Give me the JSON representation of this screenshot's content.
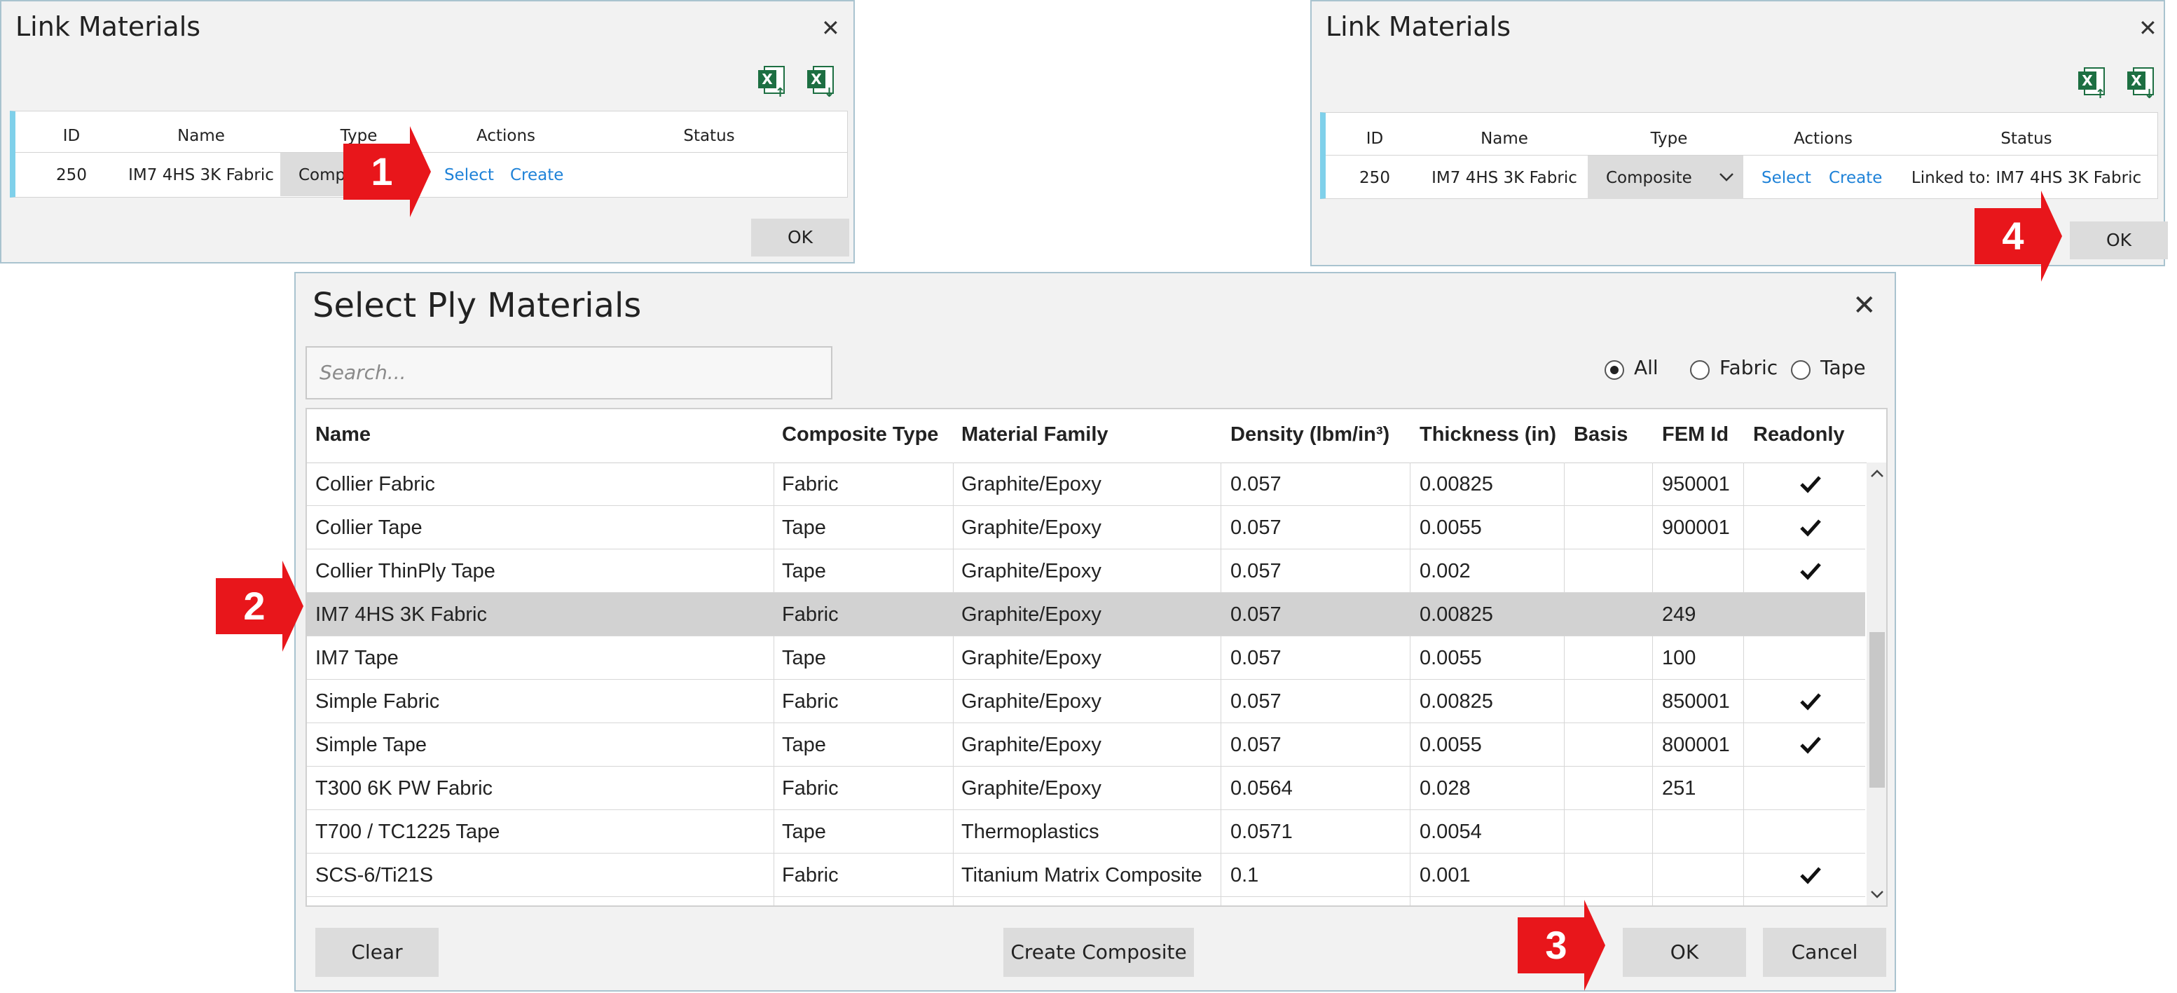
{
  "link_dialog_1": {
    "title": "Link Materials",
    "headers": {
      "id": "ID",
      "name": "Name",
      "type": "Type",
      "actions": "Actions",
      "status": "Status"
    },
    "row": {
      "id": "250",
      "name": "IM7 4HS 3K Fabric",
      "type": "Compo",
      "select": "Select",
      "create": "Create",
      "status": ""
    },
    "ok_label": "OK",
    "icons": [
      "excel-import-icon",
      "excel-export-icon",
      "close-icon"
    ]
  },
  "link_dialog_2": {
    "title": "Link Materials",
    "headers": {
      "id": "ID",
      "name": "Name",
      "type": "Type",
      "actions": "Actions",
      "status": "Status"
    },
    "row": {
      "id": "250",
      "name": "IM7 4HS 3K Fabric",
      "type": "Composite",
      "select": "Select",
      "create": "Create",
      "status": "Linked to: IM7 4HS 3K Fabric"
    },
    "ok_label": "OK",
    "icons": [
      "excel-import-icon",
      "excel-export-icon",
      "close-icon",
      "chevron-down-icon"
    ]
  },
  "select_dialog": {
    "title": "Select Ply Materials",
    "search_placeholder": "Search...",
    "filters": [
      {
        "label": "All",
        "selected": true
      },
      {
        "label": "Fabric",
        "selected": false
      },
      {
        "label": "Tape",
        "selected": false
      }
    ],
    "columns": [
      "Name",
      "Composite Type",
      "Material Family",
      "Density (lbm/in³)",
      "Thickness (in)",
      "Basis",
      "FEM Id",
      "Readonly"
    ],
    "rows": [
      {
        "name": "Collier Fabric",
        "type": "Fabric",
        "family": "Graphite/Epoxy",
        "density": "0.057",
        "thickness": "0.00825",
        "basis": "",
        "fem": "950001",
        "readonly": true
      },
      {
        "name": "Collier Tape",
        "type": "Tape",
        "family": "Graphite/Epoxy",
        "density": "0.057",
        "thickness": "0.0055",
        "basis": "",
        "fem": "900001",
        "readonly": true
      },
      {
        "name": "Collier ThinPly Tape",
        "type": "Tape",
        "family": "Graphite/Epoxy",
        "density": "0.057",
        "thickness": "0.002",
        "basis": "",
        "fem": "",
        "readonly": true
      },
      {
        "name": "IM7 4HS 3K Fabric",
        "type": "Fabric",
        "family": "Graphite/Epoxy",
        "density": "0.057",
        "thickness": "0.00825",
        "basis": "",
        "fem": "249",
        "readonly": false,
        "selected": true
      },
      {
        "name": "IM7 Tape",
        "type": "Tape",
        "family": "Graphite/Epoxy",
        "density": "0.057",
        "thickness": "0.0055",
        "basis": "",
        "fem": "100",
        "readonly": false
      },
      {
        "name": "Simple Fabric",
        "type": "Fabric",
        "family": "Graphite/Epoxy",
        "density": "0.057",
        "thickness": "0.00825",
        "basis": "",
        "fem": "850001",
        "readonly": true
      },
      {
        "name": "Simple Tape",
        "type": "Tape",
        "family": "Graphite/Epoxy",
        "density": "0.057",
        "thickness": "0.0055",
        "basis": "",
        "fem": "800001",
        "readonly": true
      },
      {
        "name": "T300 6K PW Fabric",
        "type": "Fabric",
        "family": "Graphite/Epoxy",
        "density": "0.0564",
        "thickness": "0.028",
        "basis": "",
        "fem": "251",
        "readonly": false
      },
      {
        "name": "T700 / TC1225 Tape",
        "type": "Tape",
        "family": "Thermoplastics",
        "density": "0.0571",
        "thickness": "0.0054",
        "basis": "",
        "fem": "",
        "readonly": false
      },
      {
        "name": "SCS-6/Ti21S",
        "type": "Fabric",
        "family": "Titanium Matrix Composite",
        "density": "0.1",
        "thickness": "0.001",
        "basis": "",
        "fem": "",
        "readonly": true
      }
    ],
    "buttons": {
      "clear": "Clear",
      "create_composite": "Create Composite",
      "ok": "OK",
      "cancel": "Cancel"
    }
  },
  "step_markers": [
    "1",
    "2",
    "3",
    "4"
  ],
  "colors": {
    "marker_red": "#e8161b",
    "link_blue": "#1e82d8",
    "accent_cyan": "#7fd0ea",
    "excel_green": "#1d6f42"
  }
}
